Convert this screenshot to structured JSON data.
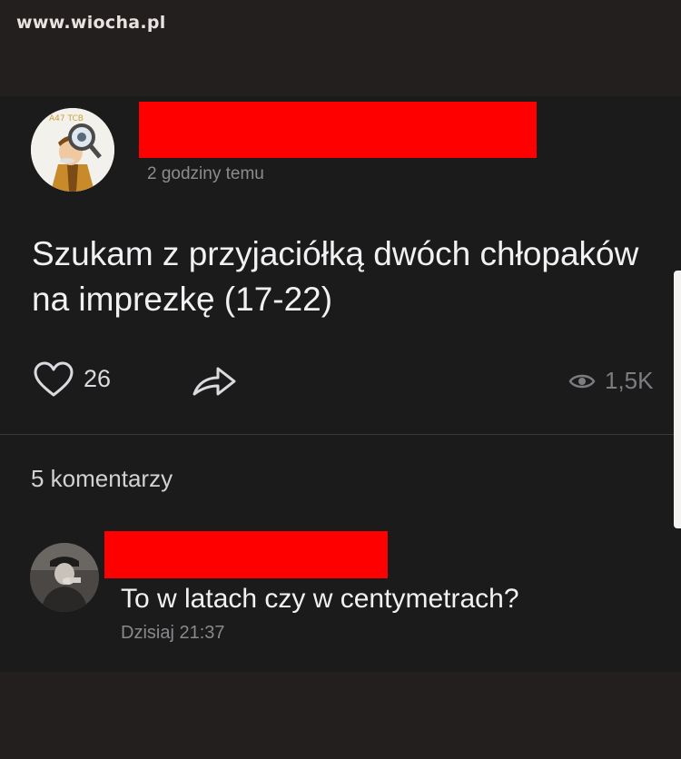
{
  "watermark": "www.wiocha.pl",
  "post": {
    "avatar_icon": "detective-cartoon-avatar",
    "author_redacted": true,
    "time": "2 godziny temu",
    "text": "Szukam z przyjaciółką dwóch chłopaków na imprezkę (17-22)",
    "likes": "26",
    "views": "1,5K"
  },
  "comments": {
    "count_label": "5 komentarzy",
    "items": [
      {
        "avatar_icon": "man-photo-avatar",
        "author_redacted": true,
        "text": "To w latach czy w centymetrach?",
        "time": "Dzisiaj 21:37"
      }
    ]
  },
  "colors": {
    "background": "#241f1f",
    "panel": "#1b1b1c",
    "redaction": "#ff0000",
    "text": "#f1f0f2",
    "muted": "#8d8b8e"
  }
}
